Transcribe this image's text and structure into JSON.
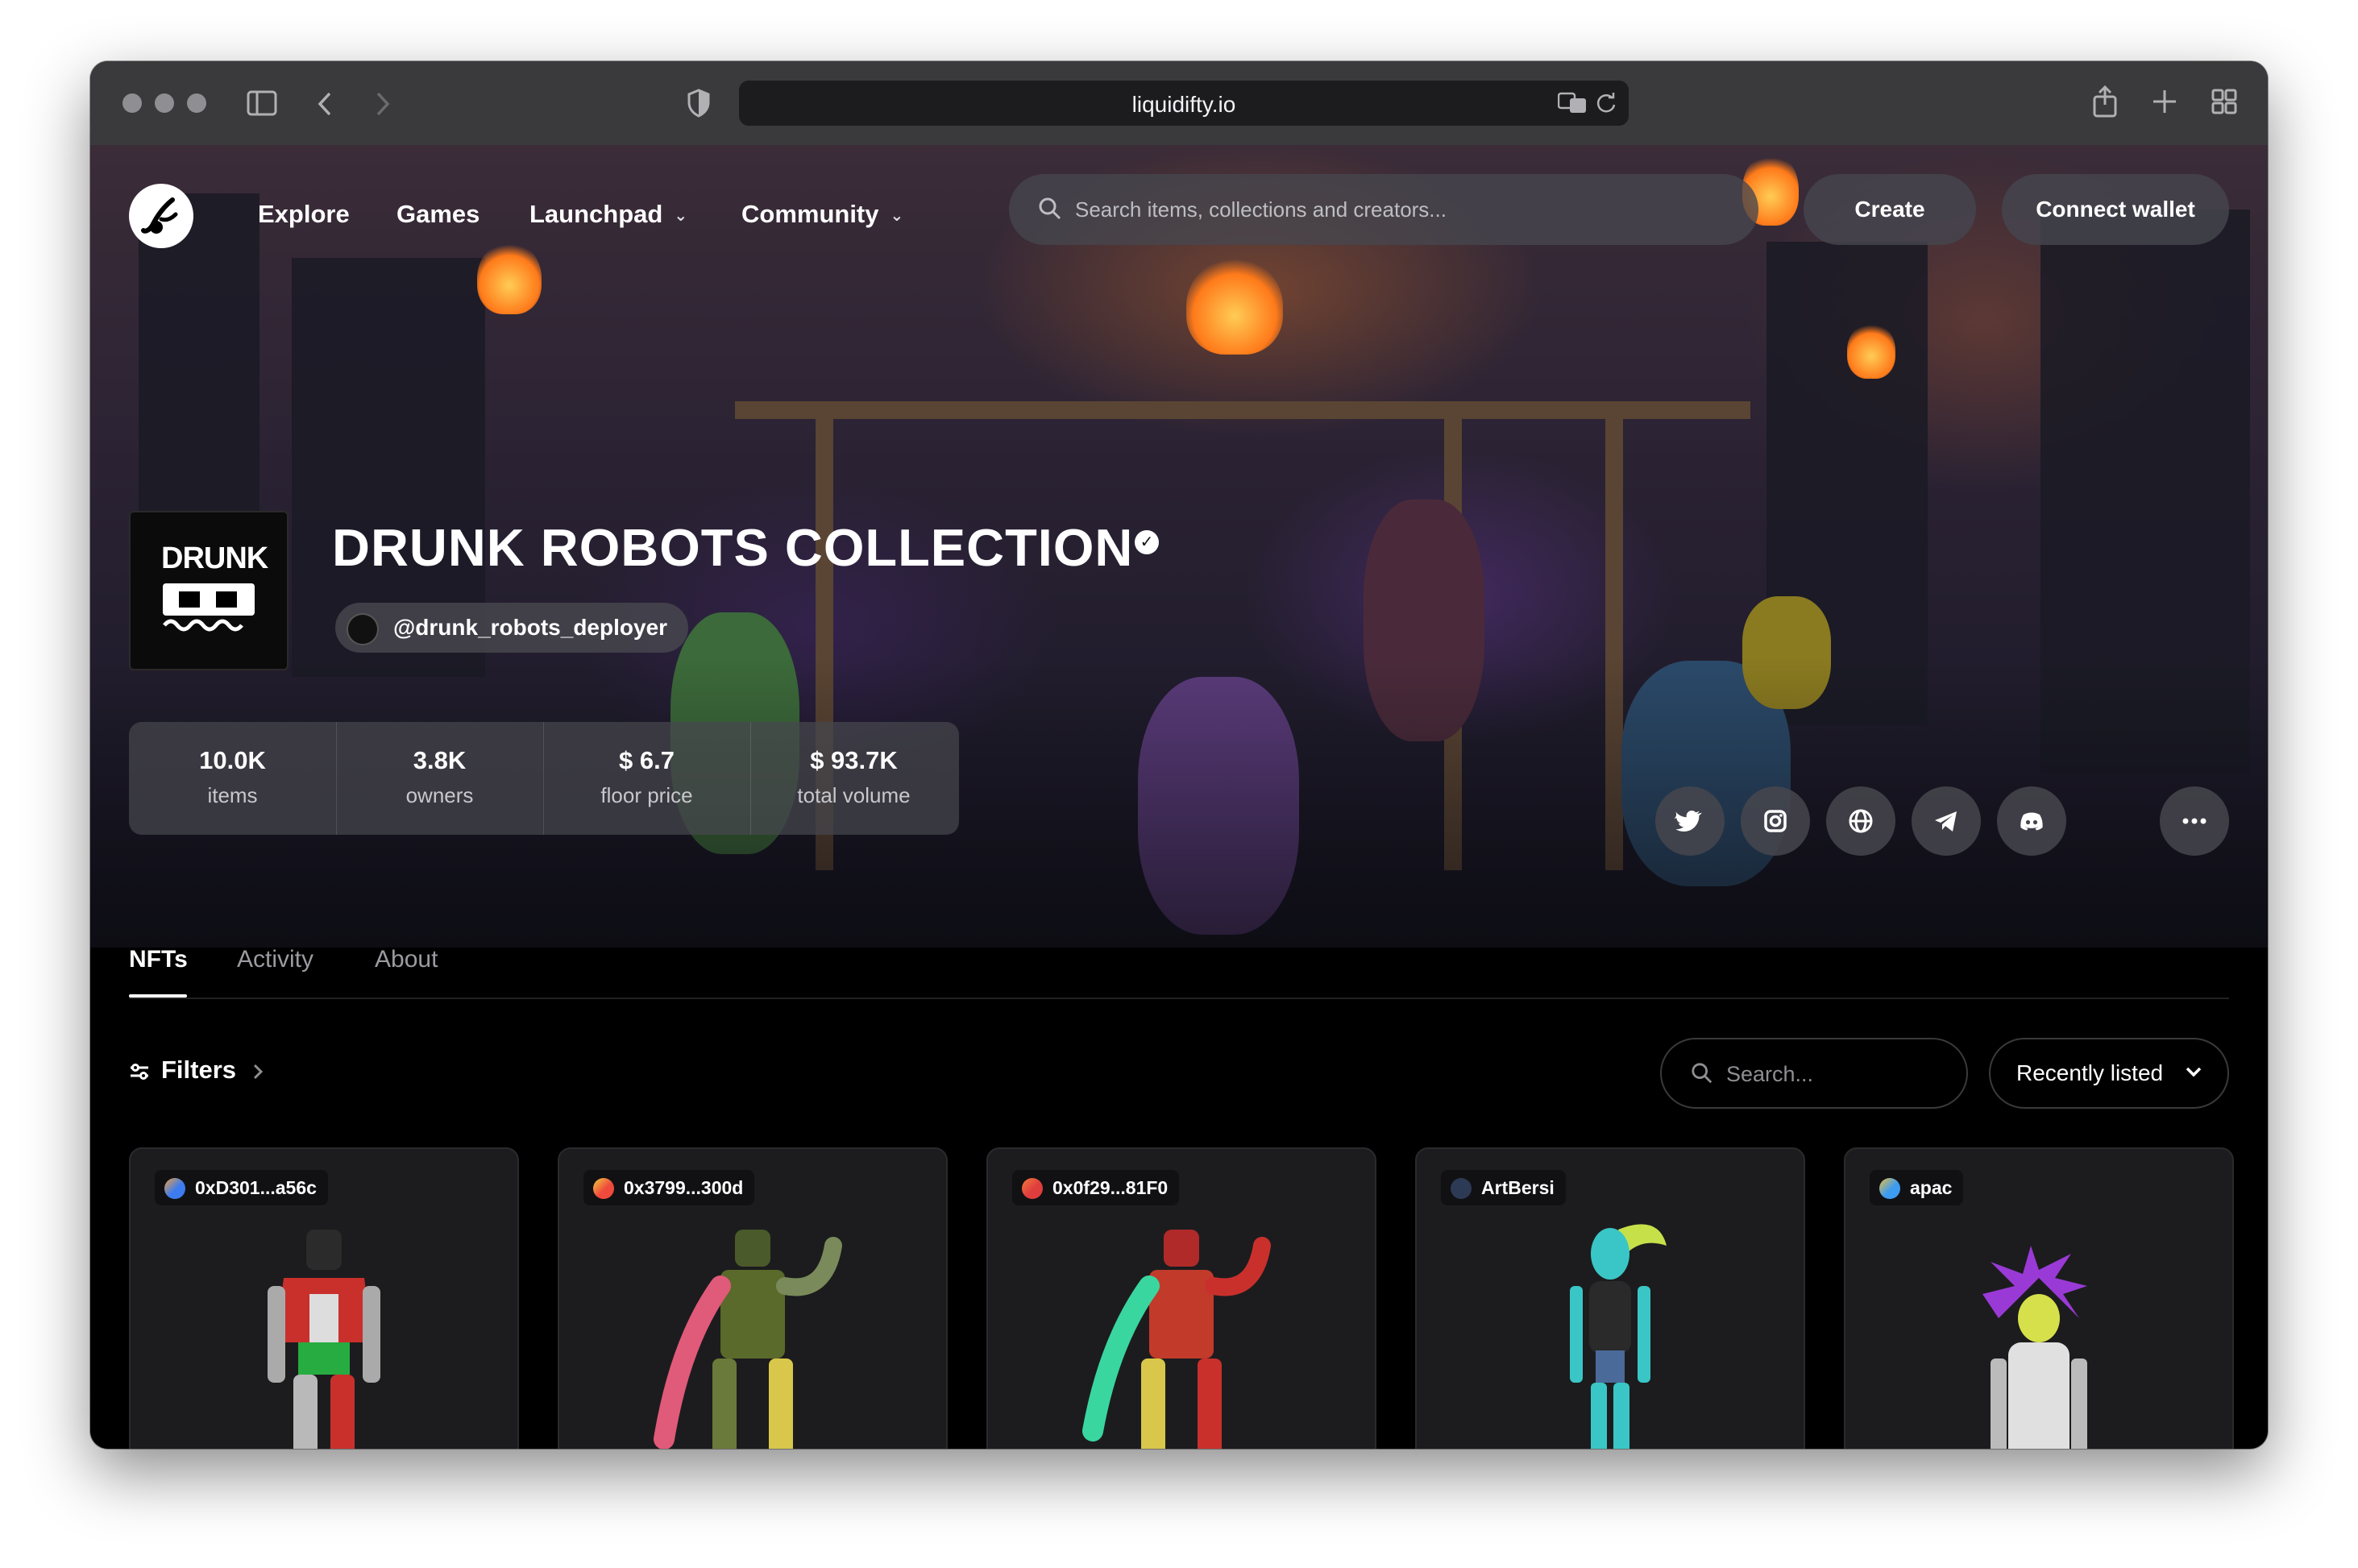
{
  "browser": {
    "url": "liquidifty.io"
  },
  "nav": {
    "links": [
      {
        "label": "Explore"
      },
      {
        "label": "Games"
      },
      {
        "label": "Launchpad"
      },
      {
        "label": "Community"
      }
    ],
    "search_placeholder": "Search items, collections and creators...",
    "create_label": "Create",
    "connect_label": "Connect wallet"
  },
  "collection": {
    "title": "DRUNK ROBOTS COLLECTION",
    "creator": "@drunk_robots_deployer",
    "avatar_text": "DRUNK",
    "stats": [
      {
        "value": "10.0K",
        "label": "items"
      },
      {
        "value": "3.8K",
        "label": "owners"
      },
      {
        "value": "$ 6.7",
        "label": "floor price"
      },
      {
        "value": "$ 93.7K",
        "label": "total volume"
      }
    ],
    "social_icons": [
      "twitter-icon",
      "instagram-icon",
      "globe-icon",
      "telegram-icon",
      "discord-icon",
      "more-icon"
    ]
  },
  "tabs": [
    {
      "label": "NFTs",
      "active": true
    },
    {
      "label": "Activity",
      "active": false
    },
    {
      "label": "About",
      "active": false
    }
  ],
  "toolbar": {
    "filters_label": "Filters",
    "search_placeholder": "Search...",
    "sort_label": "Recently listed"
  },
  "cards": [
    {
      "owner": "0xD301...a56c",
      "owner_color": "#3d7bf0"
    },
    {
      "owner": "0x3799...300d",
      "owner_color": "#f04a3d"
    },
    {
      "owner": "0x0f29...81F0",
      "owner_color": "#f06a3d"
    },
    {
      "owner": "ArtBersi",
      "owner_color": "#2d3a55"
    },
    {
      "owner": "apac",
      "owner_color": "#3d9bf0"
    }
  ],
  "colors": {
    "background": "#000000",
    "panel": "#1c1c1e",
    "pill": "#46464e"
  }
}
